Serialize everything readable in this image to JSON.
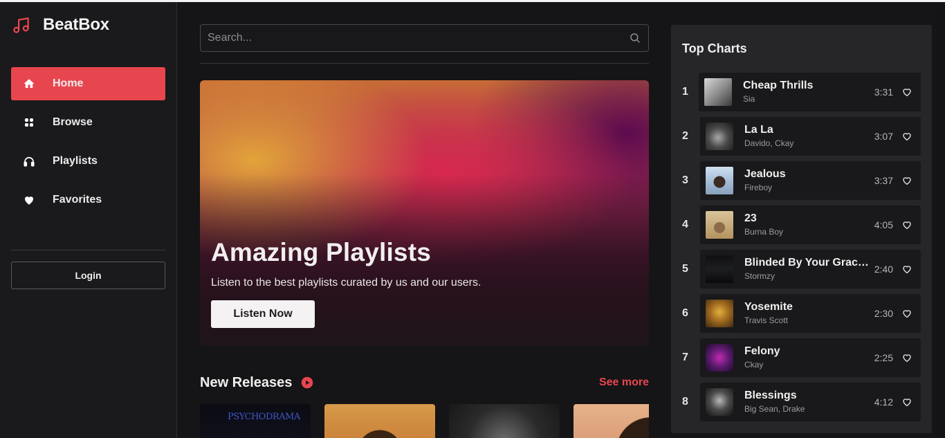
{
  "app": {
    "name": "BeatBox",
    "accent": "#e8464f"
  },
  "sidebar": {
    "items": [
      {
        "label": "Home",
        "icon": "home-icon",
        "active": true
      },
      {
        "label": "Browse",
        "icon": "grid-icon",
        "active": false
      },
      {
        "label": "Playlists",
        "icon": "headphones-icon",
        "active": false
      },
      {
        "label": "Favorites",
        "icon": "heart-icon",
        "active": false
      }
    ],
    "login_label": "Login"
  },
  "search": {
    "placeholder": "Search..."
  },
  "hero": {
    "title": "Amazing Playlists",
    "subtitle": "Listen to the best playlists curated by us and our users.",
    "button_label": "Listen Now"
  },
  "new_releases": {
    "title": "New Releases",
    "see_more": "See more",
    "cards": [
      {
        "cover_text": "PSYCHODRAMA"
      },
      {
        "cover_text": ""
      },
      {
        "cover_text": ""
      },
      {
        "cover_text": ""
      }
    ]
  },
  "top_charts": {
    "title": "Top Charts",
    "tracks": [
      {
        "rank": "1",
        "title": "Cheap Thrills",
        "artist": "Sia",
        "duration": "3:31"
      },
      {
        "rank": "2",
        "title": "La La",
        "artist": "Davido, Ckay",
        "duration": "3:07"
      },
      {
        "rank": "3",
        "title": "Jealous",
        "artist": "Fireboy",
        "duration": "3:37"
      },
      {
        "rank": "4",
        "title": "23",
        "artist": "Burna Boy",
        "duration": "4:05"
      },
      {
        "rank": "5",
        "title": "Blinded By Your Grace...",
        "artist": "Stormzy",
        "duration": "2:40"
      },
      {
        "rank": "6",
        "title": "Yosemite",
        "artist": "Travis Scott",
        "duration": "2:30"
      },
      {
        "rank": "7",
        "title": "Felony",
        "artist": "Ckay",
        "duration": "2:25"
      },
      {
        "rank": "8",
        "title": "Blessings",
        "artist": "Big Sean, Drake",
        "duration": "4:12"
      }
    ]
  }
}
